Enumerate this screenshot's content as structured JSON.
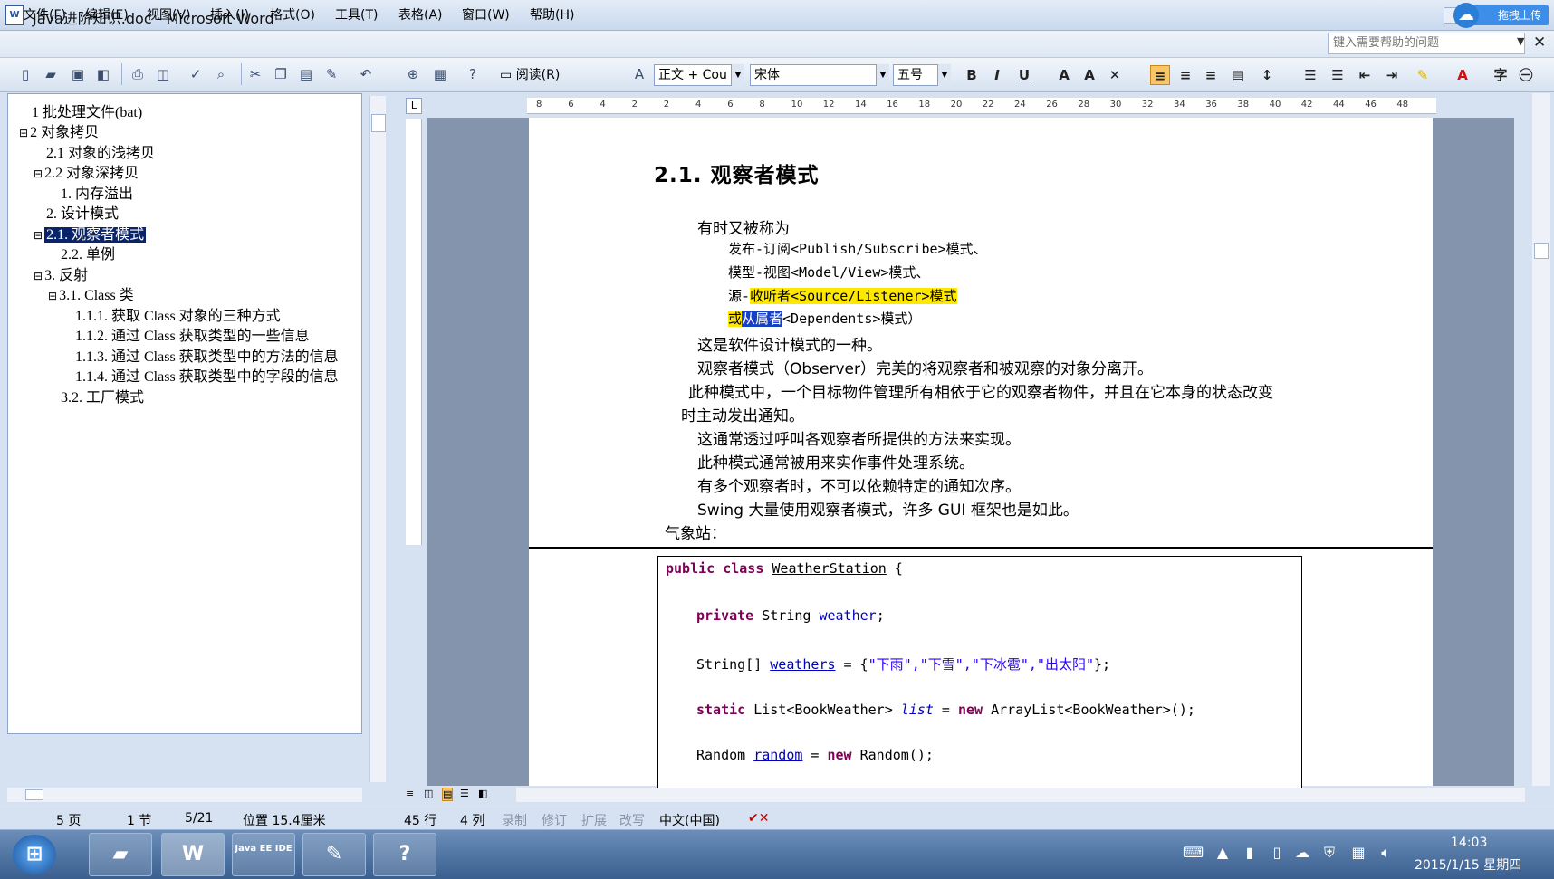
{
  "window": {
    "title": "Java进阶知识.doc - Microsoft Word",
    "upload_label": "拖拽上传"
  },
  "menu": [
    "文件(F)",
    "编辑(E)",
    "视图(V)",
    "插入(I)",
    "格式(O)",
    "工具(T)",
    "表格(A)",
    "窗口(W)",
    "帮助(H)"
  ],
  "help_box": {
    "placeholder": "键入需要帮助的问题"
  },
  "toolbar": {
    "read_label": "阅读(R)",
    "style": "正文 + Cou",
    "font": "宋体",
    "size": "五号",
    "bold": "B",
    "italic": "I",
    "underline": "U"
  },
  "doc_map": {
    "items": [
      {
        "label": "1 批处理文件(bat)",
        "expander": ""
      },
      {
        "label": "2 对象拷贝",
        "expander": "⊟"
      },
      {
        "label": "2.1 对象的浅拷贝",
        "expander": ""
      },
      {
        "label": "2.2 对象深拷贝",
        "expander": "⊟"
      },
      {
        "label": "1. 内存溢出",
        "expander": ""
      },
      {
        "label": "2. 设计模式",
        "expander": ""
      },
      {
        "label": "2.1. 观察者模式",
        "expander": "⊟",
        "selected": true
      },
      {
        "label": "2.2.  单例",
        "expander": ""
      },
      {
        "label": "3. 反射",
        "expander": "⊟"
      },
      {
        "label": "3.1. Class 类",
        "expander": "⊟"
      },
      {
        "label": "1.1.1. 获取 Class 对象的三种方式",
        "expander": ""
      },
      {
        "label": "1.1.2. 通过 Class 获取类型的一些信息",
        "expander": ""
      },
      {
        "label": "1.1.3. 通过 Class 获取类型中的方法的信息",
        "expander": ""
      },
      {
        "label": "1.1.4. 通过 Class 获取类型中的字段的信息",
        "expander": ""
      },
      {
        "label": "3.2.  工厂模式",
        "expander": ""
      }
    ]
  },
  "ruler": [
    "8",
    "6",
    "4",
    "2",
    "2",
    "4",
    "6",
    "8",
    "10",
    "12",
    "14",
    "16",
    "18",
    "20",
    "22",
    "24",
    "26",
    "28",
    "30",
    "32",
    "34",
    "36",
    "38",
    "40",
    "42",
    "44",
    "46",
    "48"
  ],
  "document": {
    "heading": "2.1. 观察者模式",
    "para_intro": "有时又被称为",
    "alias_1": "发布-订阅<Publish/Subscribe>模式、",
    "alias_2": "模型-视图<Model/View>模式、",
    "alias_3a": "源-",
    "alias_3b": "收听者<Source/Listener>模式",
    "alias_4a": "或",
    "alias_4b": "从属者",
    "alias_4c": "<Dependents>模式）",
    "line_1": "这是软件设计模式的一种。",
    "line_2": "观察者模式（Observer）完美的将观察者和被观察的对象分离开。",
    "line_3": "此种模式中，一个目标物件管理所有相依于它的观察者物件，并且在它本身的状态改变",
    "line_4": "时主动发出通知。",
    "line_5": "这通常透过呼叫各观察者所提供的方法来实现。",
    "line_6": "此种模式通常被用来实作事件处理系统。",
    "line_7": "有多个观察者时，不可以依赖特定的通知次序。",
    "line_8": "Swing 大量使用观察者模式，许多 GUI 框架也是如此。",
    "line_9": "气象站："
  },
  "code": {
    "l1_kw": "public class",
    "l1_name": "WeatherStation",
    "l1_rest": " {",
    "l2_kw": "private",
    "l2_type": " String ",
    "l2_field": "weather",
    "l2_rest": ";",
    "l3_type": "String[] ",
    "l3_field": "weathers",
    "l3_eq": " = {",
    "l3_strs": "\"下雨\",\"下雪\",\"下冰雹\",\"出太阳\"",
    "l3_rest": "};",
    "l4_kw": "static",
    "l4_type": " List<BookWeather> ",
    "l4_field": "list",
    "l4_eq": " = ",
    "l4_new": "new",
    "l4_rest": " ArrayList<BookWeather>();",
    "l5_type": "Random ",
    "l5_field": "random",
    "l5_eq": " = ",
    "l5_new": "new",
    "l5_rest": " Random();"
  },
  "status": {
    "page": "5 页",
    "section": "1 节",
    "pages": "5/21",
    "position": "位置 15.4厘米",
    "line": "45 行",
    "col": "4 列",
    "rec": "录制",
    "trk": "修订",
    "ext": "扩展",
    "ovr": "改写",
    "lang": "中文(中国)"
  },
  "taskbar": {
    "word_label": "W",
    "ide_label": "Java EE IDE",
    "time": "14:03",
    "date": "2015/1/15 星期四"
  },
  "colors": {
    "selection": "#0a246a",
    "highlight_yellow": "#ffe800",
    "keyword": "#7f0055",
    "field": "#0000c0",
    "string": "#2a00ff"
  }
}
